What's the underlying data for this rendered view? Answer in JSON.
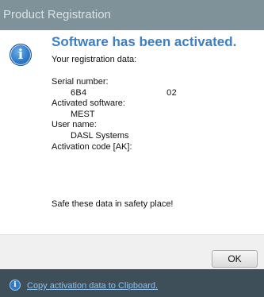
{
  "window": {
    "title": "Product Registration"
  },
  "message": {
    "headline": "Software has been activated.",
    "subhead": "Your registration data:",
    "serial_label": "Serial number:",
    "serial_value": "6B4                              02",
    "software_label": "Activated software:",
    "software_value": "MEST",
    "user_label": "User name:",
    "user_value": "DASL Systems",
    "code_label": "Activation code [AK]:",
    "code_value": "                                                     ",
    "safe_note": "Safe these data in safety place!"
  },
  "buttons": {
    "ok_label": "OK"
  },
  "footer": {
    "link_text": "Copy activation data to Clipboard.",
    "icon": "info-icon"
  },
  "colors": {
    "accent": "#3c7fc4",
    "frame": "#3f4f5a",
    "titlebar": "#7f9299",
    "link": "#8fc3f0"
  }
}
